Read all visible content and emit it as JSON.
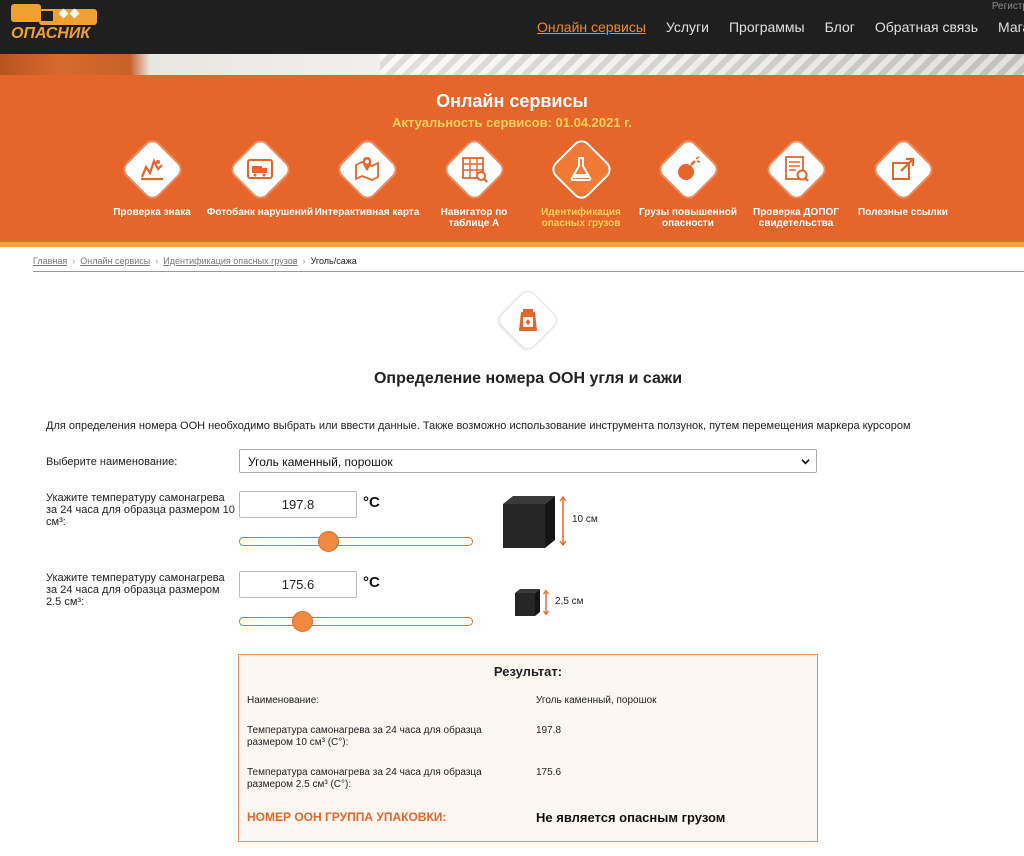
{
  "header": {
    "logo_text": "ОПАСНИК",
    "register_label": "Регистр",
    "nav": [
      {
        "label": "Онлайн сервисы",
        "active": true
      },
      {
        "label": "Услуги",
        "active": false
      },
      {
        "label": "Программы",
        "active": false
      },
      {
        "label": "Блог",
        "active": false
      },
      {
        "label": "Обратная связь",
        "active": false
      },
      {
        "label": "Магаз",
        "active": false
      }
    ]
  },
  "banner": {
    "title": "Онлайн сервисы",
    "subtitle": "Актуальность сервисов: 01.04.2021 г.",
    "services": [
      {
        "label": "Проверка знака",
        "icon": "hazard-sign-icon",
        "active": false
      },
      {
        "label": "Фотобанк нарушений",
        "icon": "photo-truck-icon",
        "active": false
      },
      {
        "label": "Интерактивная карта",
        "icon": "map-pin-icon",
        "active": false
      },
      {
        "label": "Навигатор по таблице А",
        "icon": "table-search-icon",
        "active": false
      },
      {
        "label": "Идентификация опасных грузов",
        "icon": "flask-icon",
        "active": true
      },
      {
        "label": "Грузы повышенной опасности",
        "icon": "bomb-icon",
        "active": false
      },
      {
        "label": "Проверка ДОПОГ свидетельства",
        "icon": "certificate-search-icon",
        "active": false
      },
      {
        "label": "Полезные ссылки",
        "icon": "external-link-icon",
        "active": false
      }
    ]
  },
  "breadcrumb": {
    "items": [
      "Главная",
      "Онлайн сервисы",
      "Идентификация опасных грузов"
    ],
    "current": "Уголь/сажа"
  },
  "page": {
    "title": "Определение номера ООН угля и сажи",
    "intro": "Для определения номера ООН необходимо выбрать или ввести данные. Также возможно использование инструмента ползунок, путем перемещения маркера курсором"
  },
  "form": {
    "name_label": "Выберите наименование:",
    "name_value": "Уголь каменный, порошок",
    "temp1_label": "Укажите температуру самонагрева за 24 часа для образца размером 10 см³:",
    "temp1_value": "197.8",
    "temp1_slider_fraction": 0.37,
    "temp1_cube_caption": "10 см",
    "temp2_label": "Укажите температуру самонагрева за 24 часа для образца размером 2.5 см³:",
    "temp2_value": "175.6",
    "temp2_slider_fraction": 0.25,
    "temp2_cube_caption": "2,5 см",
    "unit": "°C"
  },
  "result": {
    "title": "Результат:",
    "rows": [
      {
        "label": "Наименование:",
        "value": "Уголь каменный, порошок"
      },
      {
        "label": "Температура самонагрева за 24 часа для образца размером 10 см³ (С°):",
        "value": "197.8"
      },
      {
        "label": "Температура самонагрева за 24 часа для образца размером 2.5 см³ (С°):",
        "value": "175.6"
      }
    ],
    "final_label": "НОМЕР ООН ГРУППА УПАКОВКИ:",
    "final_value": "Не является опасным грузом"
  },
  "colors": {
    "accent": "#e5652b",
    "accent_light": "#f4a33b",
    "subtitle": "#ffd15a",
    "topbar": "#1f1f1f"
  }
}
